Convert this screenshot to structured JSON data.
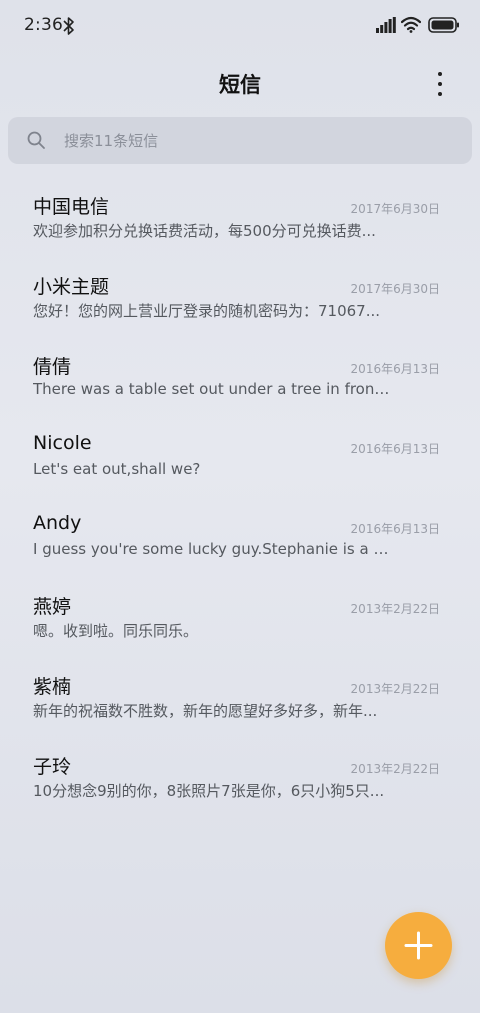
{
  "status_bar": {
    "time": "2:36",
    "icons": [
      "bluetooth-icon",
      "signal-icon",
      "wifi-icon",
      "battery-icon"
    ]
  },
  "header": {
    "title": "短信",
    "more_icon": "more-vertical-icon"
  },
  "search": {
    "placeholder": "搜索11条短信",
    "icon": "search-icon"
  },
  "messages": [
    {
      "name": "中国电信",
      "date": "2017年6月30日",
      "preview": "欢迎参加积分兑换话费活动，每500分可兑换话费..."
    },
    {
      "name": "小米主题",
      "date": "2017年6月30日",
      "preview": "您好！您的网上营业厅登录的随机密码为：71067..."
    },
    {
      "name": "倩倩",
      "date": "2016年6月13日",
      "preview": "There was a table set out under a tree in front o..."
    },
    {
      "name": "Nicole",
      "date": "2016年6月13日",
      "preview": "Let's eat out,shall we?"
    },
    {
      "name": "Andy",
      "date": "2016年6月13日",
      "preview": "I guess you're some lucky guy.Stephanie is a n..."
    },
    {
      "name": "燕婷",
      "date": "2013年2月22日",
      "preview": "嗯。收到啦。同乐同乐。"
    },
    {
      "name": "紫楠",
      "date": "2013年2月22日",
      "preview": "新年的祝福数不胜数，新年的愿望好多好多，新年..."
    },
    {
      "name": "子玲",
      "date": "2013年2月22日",
      "preview": "10分想念9别的你，8张照片7张是你，6只小狗5只..."
    }
  ],
  "fab": {
    "icon": "plus-icon"
  },
  "colors": {
    "accent": "#f6ad3e",
    "background": "#e2e5ec",
    "search_bg": "#d2d5de",
    "date_text": "#9a9ea8",
    "preview_text": "#55595f"
  }
}
